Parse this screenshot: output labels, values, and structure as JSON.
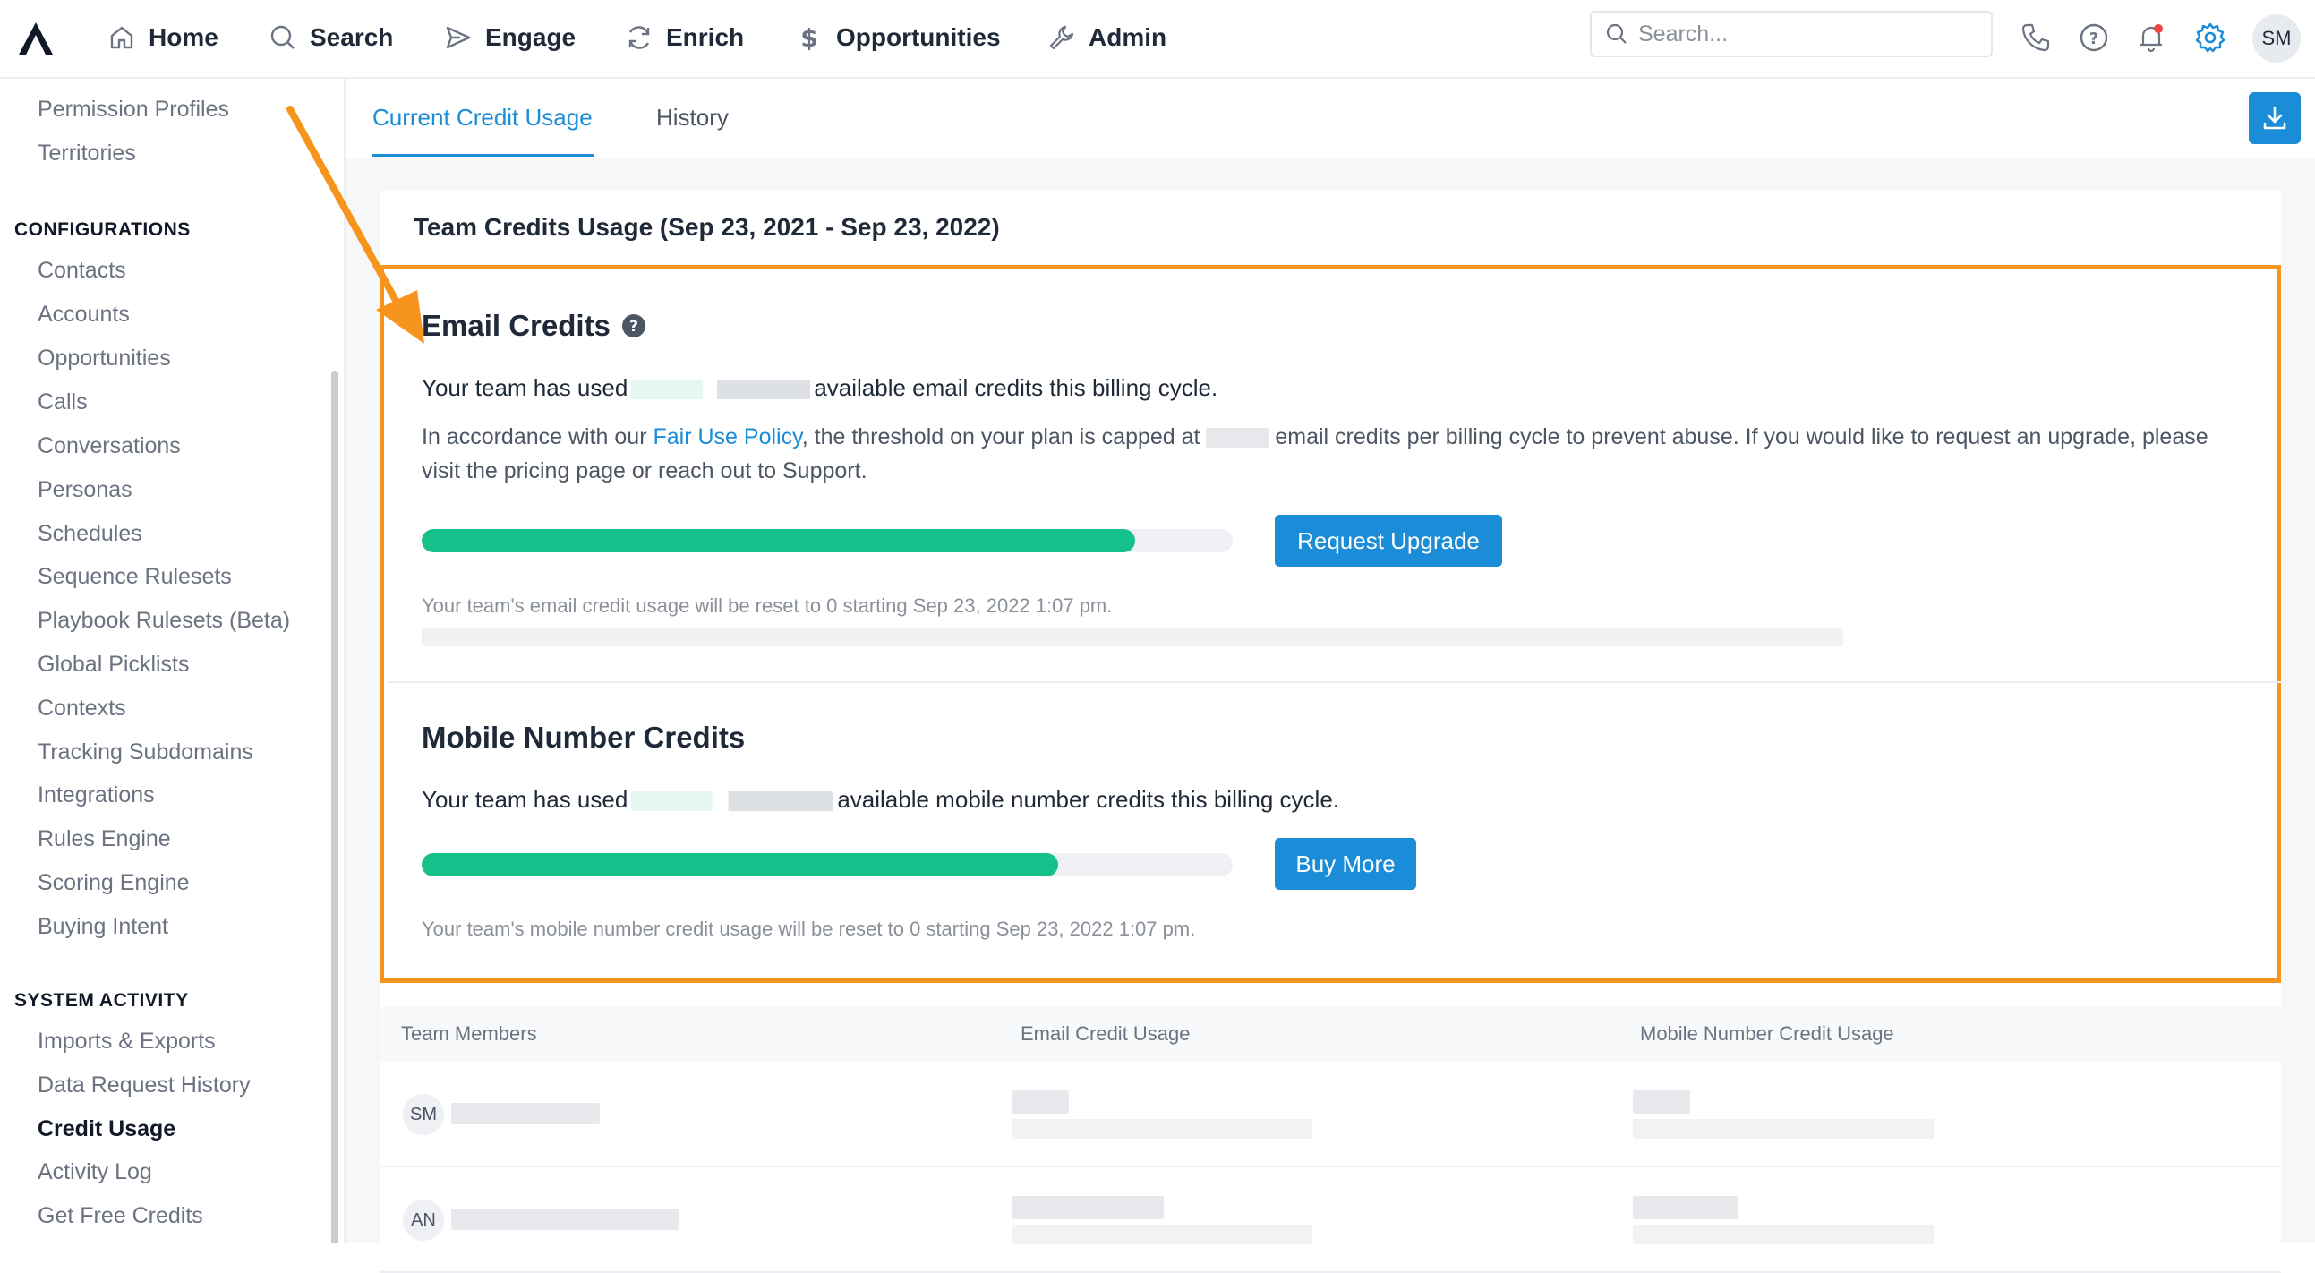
{
  "nav": {
    "items": [
      {
        "label": "Home",
        "icon": "home-icon"
      },
      {
        "label": "Search",
        "icon": "search-icon"
      },
      {
        "label": "Engage",
        "icon": "send-icon"
      },
      {
        "label": "Enrich",
        "icon": "refresh-icon"
      },
      {
        "label": "Opportunities",
        "icon": "dollar-icon"
      },
      {
        "label": "Admin",
        "icon": "wrench-icon"
      }
    ],
    "search_placeholder": "Search...",
    "user_initials": "SM"
  },
  "sidebar": {
    "top_items": [
      "Permission Profiles",
      "Territories"
    ],
    "configurations_heading": "CONFIGURATIONS",
    "configurations": [
      "Contacts",
      "Accounts",
      "Opportunities",
      "Calls",
      "Conversations",
      "Personas",
      "Schedules",
      "Sequence Rulesets",
      "Playbook Rulesets (Beta)",
      "Global Picklists",
      "Contexts",
      "Tracking Subdomains",
      "Integrations",
      "Rules Engine",
      "Scoring Engine",
      "Buying Intent"
    ],
    "system_heading": "SYSTEM ACTIVITY",
    "system": [
      "Imports & Exports",
      "Data Request History",
      "Credit Usage",
      "Activity Log",
      "Get Free Credits"
    ],
    "active": "Credit Usage"
  },
  "tabs": {
    "current": "Current Credit Usage",
    "history": "History"
  },
  "card": {
    "title": "Team Credits Usage (Sep 23, 2021 - Sep 23, 2022)"
  },
  "email": {
    "title": "Email Credits",
    "used_prefix": "Your team has used",
    "used_suffix": "available email credits this billing cycle.",
    "policy_pre": "In accordance with our ",
    "policy_link": "Fair Use Policy",
    "policy_mid": ", the threshold on your plan is capped at ",
    "policy_post": " email credits per billing cycle to prevent abuse. If you would like to request an upgrade, please visit the pricing page or reach out to Support.",
    "progress": 0.88,
    "button": "Request Upgrade",
    "reset_note": "Your team's email credit usage will be reset to 0 starting Sep 23, 2022 1:07 pm."
  },
  "mobile": {
    "title": "Mobile Number Credits",
    "used_prefix": "Your team has used",
    "used_suffix": "available mobile number credits this billing cycle.",
    "progress": 0.785,
    "button": "Buy More",
    "reset_note": "Your team's mobile number credit usage will be reset to 0 starting Sep 23, 2022 1:07 pm."
  },
  "table": {
    "headers": [
      "Team Members",
      "Email Credit Usage",
      "Mobile Number Credit Usage"
    ],
    "rows": [
      {
        "initials": "SM"
      },
      {
        "initials": "AN"
      }
    ]
  },
  "colors": {
    "accent": "#1a8cd8",
    "progress": "#16c08a",
    "highlight": "#f7941d"
  }
}
